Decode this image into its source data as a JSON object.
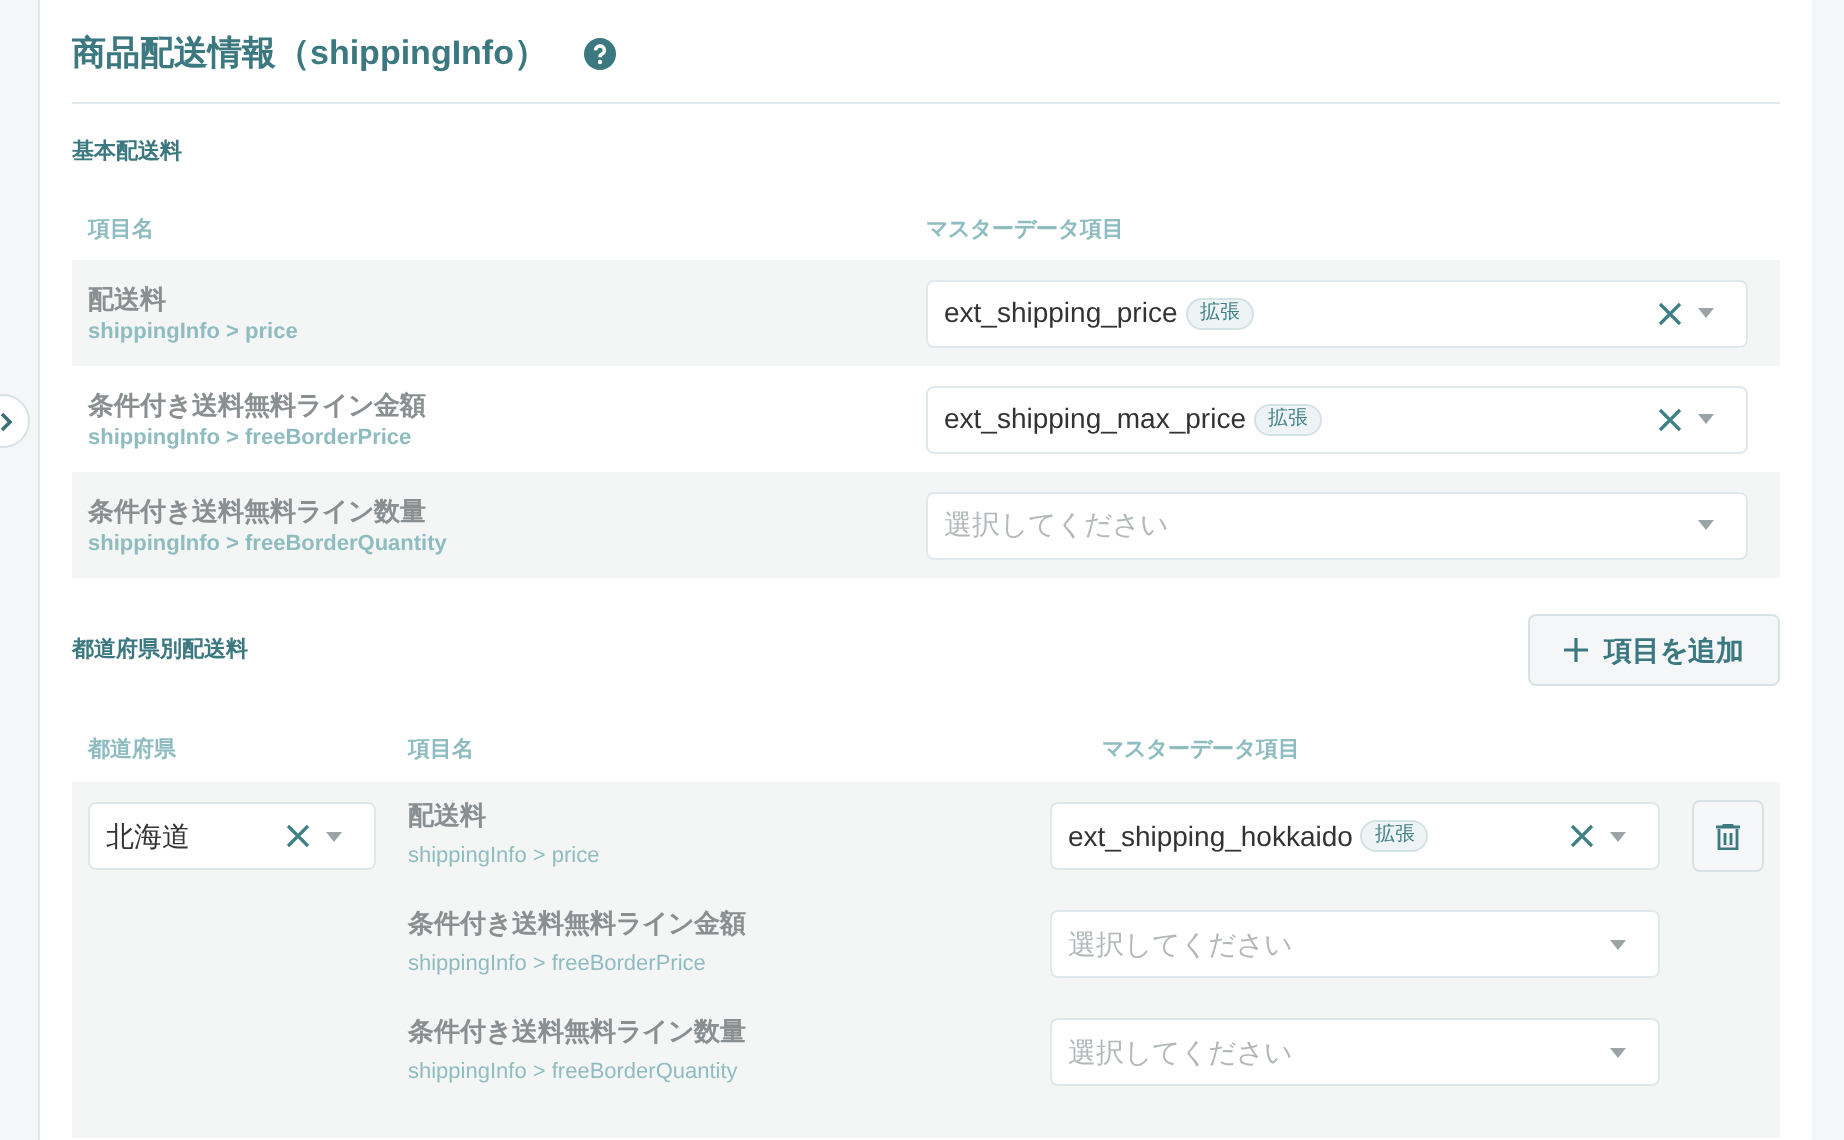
{
  "section": {
    "title": "商品配送情報（shippingInfo）"
  },
  "basic": {
    "heading": "基本配送料",
    "columns": [
      "項目名",
      "マスターデータ項目"
    ],
    "rows": [
      {
        "name": "配送料",
        "path": "shippingInfo > price",
        "select": {
          "value": "ext_shipping_price",
          "tag": "拡張"
        }
      },
      {
        "name": "条件付き送料無料ライン金額",
        "path": "shippingInfo > freeBorderPrice",
        "select": {
          "value": "ext_shipping_max_price",
          "tag": "拡張"
        }
      },
      {
        "name": "条件付き送料無料ライン数量",
        "path": "shippingInfo > freeBorderQuantity",
        "select": {
          "placeholder": "選択してください"
        }
      }
    ]
  },
  "prefecture": {
    "heading": "都道府県別配送料",
    "add_button": "項目を追加",
    "columns": [
      "都道府県",
      "項目名",
      "マスターデータ項目"
    ],
    "groups": [
      {
        "prefecture": "北海道",
        "rows": [
          {
            "name": "配送料",
            "path": "shippingInfo > price",
            "select": {
              "value": "ext_shipping_hokkaido",
              "tag": "拡張"
            }
          },
          {
            "name": "条件付き送料無料ライン金額",
            "path": "shippingInfo > freeBorderPrice",
            "select": {
              "placeholder": "選択してください"
            }
          },
          {
            "name": "条件付き送料無料ライン数量",
            "path": "shippingInfo > freeBorderQuantity",
            "select": {
              "placeholder": "選択してください"
            }
          }
        ]
      }
    ]
  }
}
